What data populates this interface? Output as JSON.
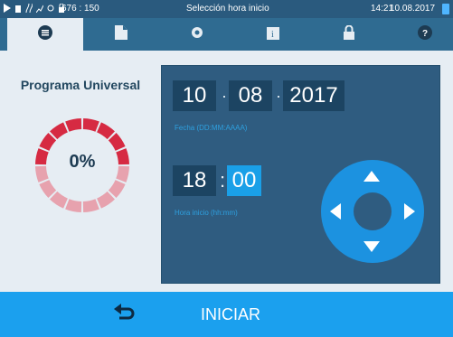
{
  "statusbar": {
    "coords": "676 : 150",
    "title": "Selección hora inicio",
    "time": "14:21",
    "date": "10.08.2017",
    "colors": {
      "bg": "#2a5a7e",
      "indicator": "#4fb5ff"
    }
  },
  "tabs": [
    {
      "name": "tab-menu",
      "icon": "menu-icon"
    },
    {
      "name": "tab-document",
      "icon": "document-icon"
    },
    {
      "name": "tab-settings",
      "icon": "gear-icon"
    },
    {
      "name": "tab-info",
      "icon": "info-icon"
    },
    {
      "name": "tab-lock",
      "icon": "lock-icon"
    },
    {
      "name": "tab-help",
      "icon": "help-icon"
    }
  ],
  "left": {
    "program_title": "Programa Universal",
    "progress_text": "0%",
    "progress_value": 0
  },
  "schedule": {
    "day": "10",
    "month": "08",
    "year": "2017",
    "date_sep": "·",
    "date_label": "Fecha (DD:MM:AAAA)",
    "hour": "18",
    "minute": "00",
    "time_sep": ":",
    "time_label": "Hora inicio (hh:mm)"
  },
  "dpad": {
    "icon": "dpad-icon"
  },
  "bottombar": {
    "start_label": "INICIAR",
    "back_icon": "back-arrow-icon"
  },
  "colors": {
    "tabbar": "#2f6b91",
    "active_tab": "#e6edf3",
    "panel": "#2f5c80",
    "field": "#1c4462",
    "selected_field": "#1aa0e8",
    "dpad": "#1c92e0",
    "bottombar": "#1ba0ee",
    "gauge_a": "#d62a42",
    "gauge_b": "#e7a2ae"
  }
}
